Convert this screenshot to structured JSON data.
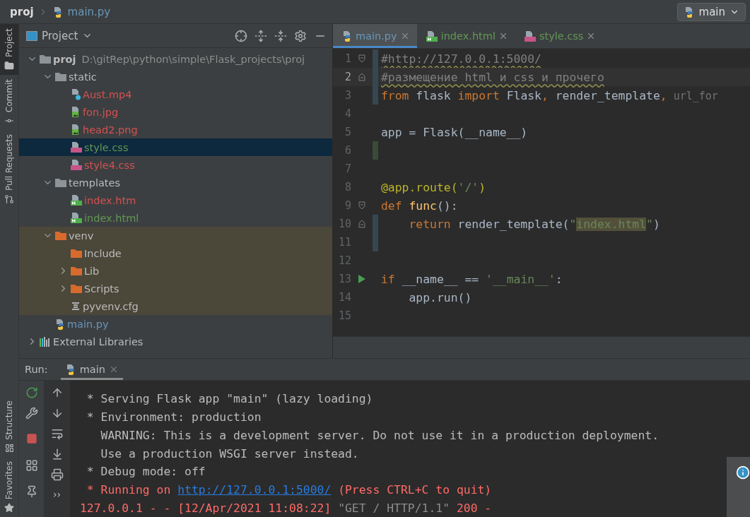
{
  "breadcrumb": [
    {
      "label": "proj",
      "kind": "folder"
    },
    {
      "label": "main.py",
      "kind": "python"
    }
  ],
  "run_config": {
    "label": "main"
  },
  "left_stripe": {
    "top": [
      {
        "label": "Project",
        "kind": "folder",
        "selected": true
      },
      {
        "label": "Commit",
        "kind": "commit",
        "selected": false
      },
      {
        "label": "Pull Requests",
        "kind": "pull",
        "selected": false
      }
    ],
    "bottom": [
      {
        "label": "Structure",
        "kind": "structure",
        "selected": false
      },
      {
        "label": "Favorites",
        "kind": "star",
        "selected": false
      }
    ]
  },
  "project_panel": {
    "title": "Project",
    "tree": [
      {
        "label": "proj",
        "path": "D:\\gitRep\\python\\simple\\Flask_projects\\proj",
        "kind": "folder",
        "color": "#bbbbbb",
        "expanded": true,
        "selected": false,
        "excluded": false,
        "children": [
          {
            "label": "static",
            "kind": "folder",
            "color": "#bbbbbb",
            "expanded": true,
            "selected": false,
            "excluded": false,
            "children": [
              {
                "label": "Aust.mp4",
                "kind": "unknown",
                "color": "#d25252",
                "selected": false,
                "excluded": false
              },
              {
                "label": "fon.jpg",
                "kind": "image",
                "color": "#d25252",
                "selected": false,
                "excluded": false
              },
              {
                "label": "head2.png",
                "kind": "image",
                "color": "#d25252",
                "selected": false,
                "excluded": false
              },
              {
                "label": "style.css",
                "kind": "css",
                "color": "#629755",
                "selected": true,
                "excluded": false
              },
              {
                "label": "style4.css",
                "kind": "css",
                "color": "#d25252",
                "selected": false,
                "excluded": false
              }
            ]
          },
          {
            "label": "templates",
            "kind": "folder",
            "color": "#bbbbbb",
            "expanded": true,
            "selected": false,
            "excluded": false,
            "children": [
              {
                "label": "index.htm",
                "kind": "html",
                "color": "#d25252",
                "selected": false,
                "excluded": false
              },
              {
                "label": "index.html",
                "kind": "html",
                "color": "#629755",
                "selected": false,
                "excluded": false
              }
            ]
          },
          {
            "label": "venv",
            "kind": "excluded_folder",
            "color": "#bbbbbb",
            "expanded": true,
            "selected": false,
            "excluded": true,
            "children": [
              {
                "label": "Include",
                "kind": "excluded_folder",
                "color": "#bbbbbb",
                "selected": false,
                "excluded": true
              },
              {
                "label": "Lib",
                "kind": "excluded_folder",
                "color": "#bbbbbb",
                "expanded": false,
                "selected": false,
                "excluded": true
              },
              {
                "label": "Scripts",
                "kind": "excluded_folder",
                "color": "#bbbbbb",
                "expanded": false,
                "selected": false,
                "excluded": true
              },
              {
                "label": "pyvenv.cfg",
                "kind": "config",
                "color": "#bbbbbb",
                "selected": false,
                "excluded": true
              }
            ]
          },
          {
            "label": "main.py",
            "kind": "python",
            "color": "#6897bb",
            "selected": false,
            "excluded": false
          }
        ]
      },
      {
        "label": "External Libraries",
        "kind": "libraries",
        "color": "#bbbbbb",
        "expanded": false,
        "selected": false,
        "excluded": false
      }
    ]
  },
  "editor": {
    "tabs": [
      {
        "label": "main.py",
        "kind": "python",
        "color": "#6897bb",
        "selected": true
      },
      {
        "label": "index.html",
        "kind": "html",
        "color": "#629755",
        "selected": false
      },
      {
        "label": "style.css",
        "kind": "css",
        "color": "#629755",
        "selected": false
      }
    ],
    "lines": [
      {
        "number": "1",
        "current": false,
        "modified": true,
        "added": false,
        "kind": "foldstart",
        "tokens": [
          {
            "text": "#http://127.0.0.1:5000/",
            "kind": "typo"
          }
        ]
      },
      {
        "number": "2",
        "current": true,
        "modified": true,
        "added": false,
        "kind": "foldend",
        "tokens": [
          {
            "text": "#размещение html и css и прочего",
            "kind": "typo"
          }
        ]
      },
      {
        "number": "3",
        "current": false,
        "modified": true,
        "added": false,
        "kind": "plain",
        "tokens": [
          {
            "text": "from",
            "kind": "keyword"
          },
          {
            "text": " flask ",
            "kind": "plain"
          },
          {
            "text": "import",
            "kind": "keyword"
          },
          {
            "text": " Flask",
            "kind": "plain"
          },
          {
            "text": ",",
            "kind": "keyword"
          },
          {
            "text": " render_template",
            "kind": "plain"
          },
          {
            "text": ",",
            "kind": "keyword"
          },
          {
            "text": " url_for",
            "kind": "unused"
          }
        ]
      },
      {
        "number": "4",
        "current": false,
        "modified": false,
        "added": false,
        "kind": "plain"
      },
      {
        "number": "5",
        "current": false,
        "modified": false,
        "added": false,
        "kind": "plain",
        "tokens": [
          {
            "text": "app = Flask(__name__)",
            "kind": "plain"
          }
        ]
      },
      {
        "number": "6",
        "current": false,
        "modified": false,
        "added": true,
        "kind": "plain"
      },
      {
        "number": "7",
        "current": false,
        "modified": false,
        "added": false,
        "kind": "plain"
      },
      {
        "number": "8",
        "current": false,
        "modified": false,
        "added": false,
        "kind": "plain",
        "tokens": [
          {
            "text": "@app.route(",
            "kind": "decorator"
          },
          {
            "text": "'/'",
            "kind": "string"
          },
          {
            "text": ")",
            "kind": "decorator"
          }
        ]
      },
      {
        "number": "9",
        "current": false,
        "modified": false,
        "added": false,
        "kind": "foldstart",
        "tokens": [
          {
            "text": "def",
            "kind": "keyword"
          },
          {
            "text": " func",
            "kind": "funcname"
          },
          {
            "text": "():",
            "kind": "plain"
          }
        ]
      },
      {
        "number": "10",
        "current": false,
        "modified": true,
        "added": false,
        "kind": "foldend",
        "tokens": [
          {
            "text": "    return",
            "kind": "keyword"
          },
          {
            "text": " render_template(",
            "kind": "plain"
          },
          {
            "text": "\"",
            "kind": "string"
          },
          {
            "text": "index.html",
            "kind": "highlight"
          },
          {
            "text": "\"",
            "kind": "string"
          },
          {
            "text": ")",
            "kind": "plain"
          }
        ]
      },
      {
        "number": "11",
        "current": false,
        "modified": true,
        "added": false,
        "kind": "plain"
      },
      {
        "number": "12",
        "current": false,
        "modified": false,
        "added": false,
        "kind": "plain"
      },
      {
        "number": "13",
        "current": false,
        "modified": false,
        "added": false,
        "kind": "runnable",
        "tokens": [
          {
            "text": "if",
            "kind": "keyword"
          },
          {
            "text": " __name__ == ",
            "kind": "plain"
          },
          {
            "text": "'__main__'",
            "kind": "string"
          },
          {
            "text": ":",
            "kind": "plain"
          }
        ]
      },
      {
        "number": "14",
        "current": false,
        "modified": false,
        "added": false,
        "kind": "plain",
        "tokens": [
          {
            "text": "    app.run()",
            "kind": "plain"
          }
        ]
      },
      {
        "number": "15",
        "current": false,
        "modified": false,
        "added": false,
        "kind": "plain"
      }
    ]
  },
  "run_panel": {
    "label": "Run:",
    "tab": {
      "label": "main",
      "selected": true
    },
    "more": "››",
    "console": [
      {
        "segments": [
          {
            "text": " * Serving Flask app \"main\" (lazy loading)",
            "kind": "plain"
          }
        ]
      },
      {
        "segments": [
          {
            "text": " * Environment: production",
            "kind": "plain"
          }
        ]
      },
      {
        "segments": [
          {
            "text": "   WARNING: This is a development server. Do not use it in a production deployment.",
            "kind": "plain"
          }
        ]
      },
      {
        "segments": [
          {
            "text": "   Use a production WSGI server instead.",
            "kind": "plain"
          }
        ]
      },
      {
        "segments": [
          {
            "text": " * Debug mode: off",
            "kind": "plain"
          }
        ]
      },
      {
        "segments": [
          {
            "text": " * Running on ",
            "kind": "error"
          },
          {
            "text": "http://127.0.0.1:5000/",
            "kind": "link"
          },
          {
            "text": " (Press CTRL+C to quit)",
            "kind": "error"
          }
        ]
      },
      {
        "segments": [
          {
            "text": "127.0.0.1 - - [12/Apr/2021 11:08:22] ",
            "kind": "error"
          },
          {
            "text": "\"GET / HTTP/1.1\" ",
            "kind": "dim"
          },
          {
            "text": "200 -",
            "kind": "error"
          }
        ]
      }
    ]
  }
}
